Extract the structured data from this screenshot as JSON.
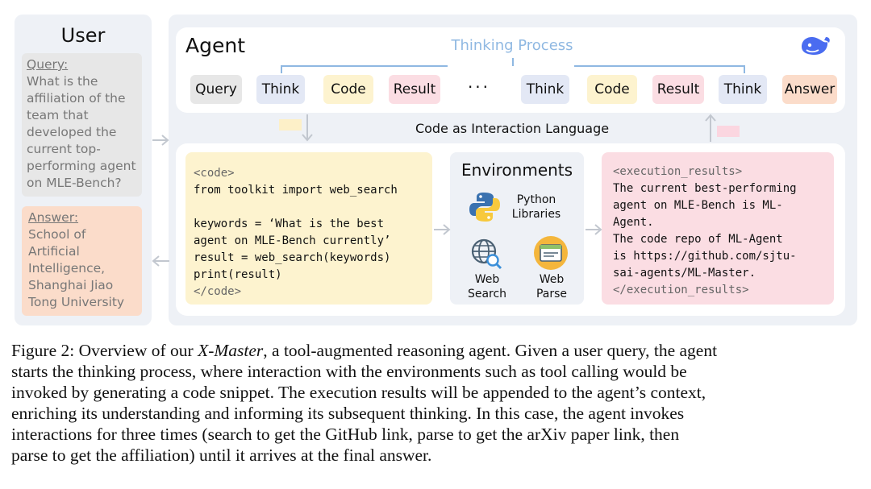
{
  "user": {
    "title": "User",
    "query_label": "Query:",
    "query_text": "What is the\naffiliation of the\nteam that\ndeveloped the\ncurrent top-\nperforming agent\non MLE-Bench?",
    "answer_label": "Answer:",
    "answer_text": "School of\nArtificial\nIntelligence,\nShanghai Jiao\nTong University"
  },
  "agent": {
    "title": "Agent",
    "thinking_process": "Thinking Process",
    "tokens": [
      "Query",
      "Think",
      "Code",
      "Result",
      "Think",
      "Code",
      "Result",
      "Think",
      "Answer"
    ],
    "ellipsis": "···",
    "interaction_label": "Code as Interaction Language",
    "logo_icon": "whale-logo-icon"
  },
  "code": {
    "lines": [
      "<code>",
      "from toolkit import web_search",
      "",
      "keywords = ‘What is the best",
      "agent on MLE-Bench currently’",
      "result = web_search(keywords)",
      "print(result)",
      "</code>"
    ]
  },
  "environments": {
    "title": "Environments",
    "python_label": "Python\nLibraries",
    "web_search_label": "Web\nSearch",
    "web_parse_label": "Web\nParse"
  },
  "results": {
    "lines": [
      "<execution_results>",
      "The current best-performing",
      "agent on MLE-Bench is ML-",
      "Agent.",
      "The code repo of ML-Agent",
      "is https://github.com/sjtu-",
      "sai-agents/ML-Master.",
      "</execution_results>"
    ]
  },
  "caption": {
    "lines": [
      "Figure 2: Overview of our ",
      "X-Master",
      ", a tool-augmented reasoning agent. Given a user query, the agent",
      "starts the thinking process, where interaction with the environments such as tool calling would be",
      "invoked by generating a code snippet. The execution results will be appended to the agent’s context,",
      "enriching its understanding and informing its subsequent thinking. In this case, the agent invokes",
      "interactions for three times (search to get the GitHub link, parse to get the arXiv paper link, then",
      "parse to get the affiliation) until it arrives at the final answer."
    ]
  },
  "colors": {
    "thinking_blue": "#8fb8e2",
    "code_yellow": "#fdf3cf",
    "result_pink": "#fbdde3",
    "answer_orange": "#fbdcca",
    "think_blue": "#e3e8f5",
    "panel": "#eef1f6"
  }
}
